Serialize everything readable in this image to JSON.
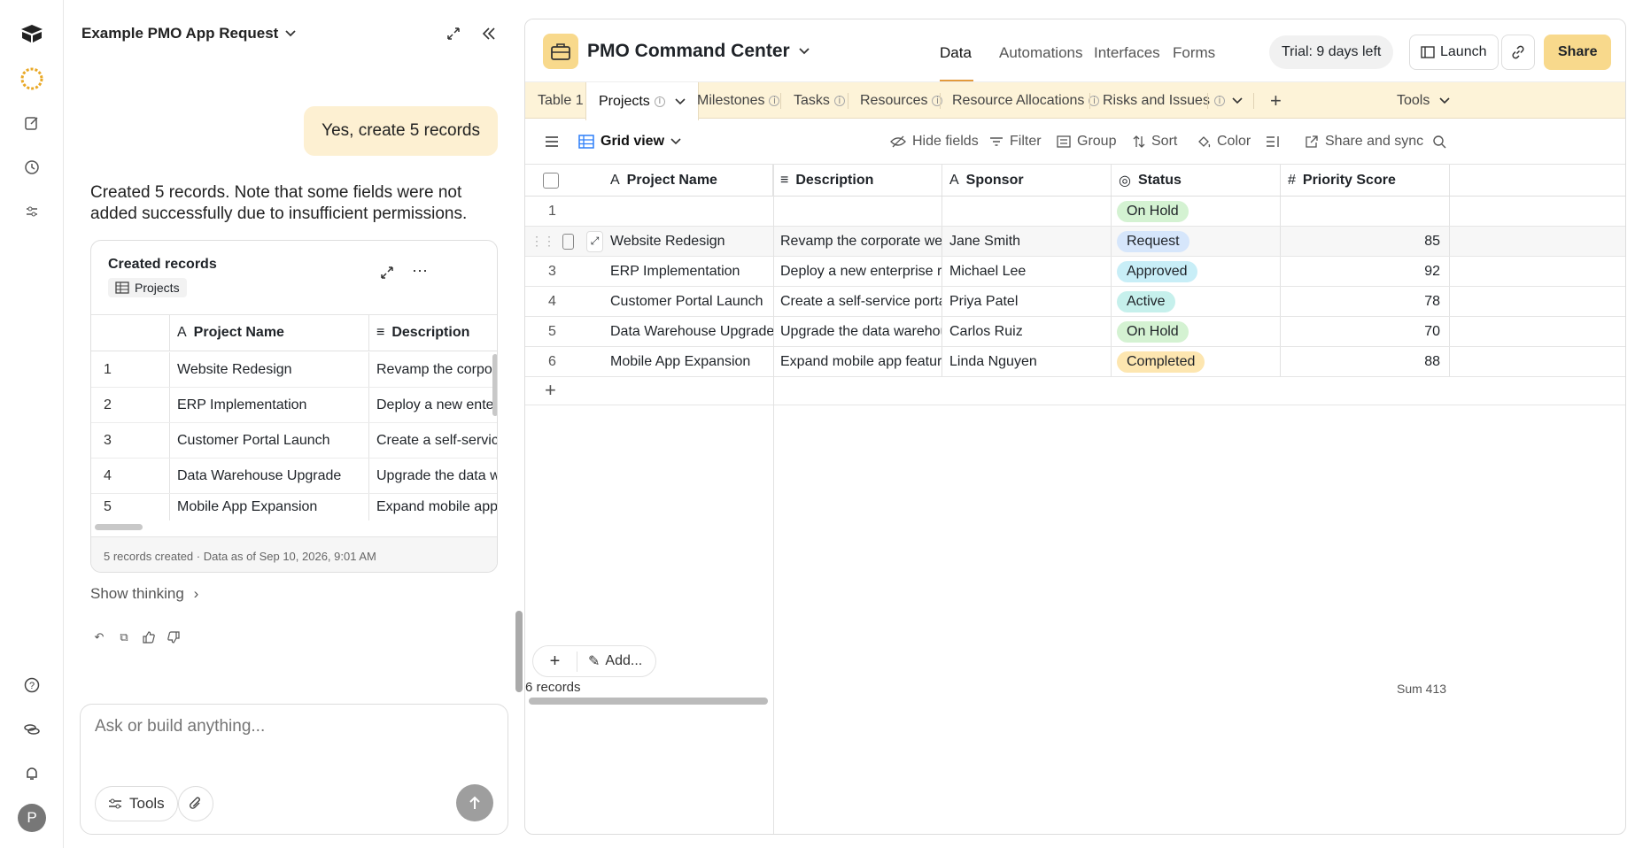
{
  "rail": {
    "icons": [
      "logo-icon",
      "sparkle-icon",
      "edit-icon",
      "history-icon",
      "sliders-icon",
      "help-icon",
      "coins-icon",
      "bell-icon"
    ],
    "avatar": "P"
  },
  "chat": {
    "title": "Example PMO App Request",
    "user_message": "Yes, create 5 records",
    "assistant_message": "Created 5 records. Note that some fields were not added successfully due to insufficient permissions.",
    "card": {
      "title": "Created records",
      "table_chip": "Projects",
      "columns": [
        "Project Name",
        "Description"
      ],
      "rows": [
        {
          "n": "1",
          "name": "Website Redesign",
          "desc": "Revamp the corpor"
        },
        {
          "n": "2",
          "name": "ERP Implementation",
          "desc": "Deploy a new enter"
        },
        {
          "n": "3",
          "name": "Customer Portal Launch",
          "desc": "Create a self-servic"
        },
        {
          "n": "4",
          "name": "Data Warehouse Upgrade",
          "desc": "Upgrade the data w"
        },
        {
          "n": "5",
          "name": "Mobile App Expansion",
          "desc": "Expand mobile app"
        }
      ],
      "footer": "5 records created · Data as of Sep 10, 2026, 9:01 AM"
    },
    "show_thinking": "Show thinking",
    "composer_placeholder": "Ask or build anything...",
    "tools_label": "Tools"
  },
  "app": {
    "base_name": "PMO Command Center",
    "nav": [
      "Data",
      "Automations",
      "Interfaces",
      "Forms"
    ],
    "trial": "Trial: 9 days left",
    "launch": "Launch",
    "share": "Share",
    "tables": [
      "Table 1",
      "Projects",
      "Milestones",
      "Tasks",
      "Resources",
      "Resource Allocations",
      "Risks and Issues"
    ],
    "tools": "Tools",
    "view_name": "Grid view",
    "toolbar": [
      "Hide fields",
      "Filter",
      "Group",
      "Sort",
      "Color",
      "Share and sync"
    ],
    "columns": [
      "Project Name",
      "Description",
      "Sponsor",
      "Status",
      "Priority Score"
    ],
    "rows": [
      {
        "n": "1",
        "name": "",
        "desc": "",
        "sponsor": "",
        "status": "On Hold",
        "score": ""
      },
      {
        "n": "",
        "name": "Website Redesign",
        "desc": "Revamp the corporate web...",
        "sponsor": "Jane Smith",
        "status": "Request",
        "score": "85"
      },
      {
        "n": "3",
        "name": "ERP Implementation",
        "desc": "Deploy a new enterprise re...",
        "sponsor": "Michael Lee",
        "status": "Approved",
        "score": "92"
      },
      {
        "n": "4",
        "name": "Customer Portal Launch",
        "desc": "Create a self-service portal ...",
        "sponsor": "Priya Patel",
        "status": "Active",
        "score": "78"
      },
      {
        "n": "5",
        "name": "Data Warehouse Upgrade",
        "desc": "Upgrade the data warehou...",
        "sponsor": "Carlos Ruiz",
        "status": "On Hold",
        "score": "70"
      },
      {
        "n": "6",
        "name": "Mobile App Expansion",
        "desc": "Expand mobile app feature...",
        "sponsor": "Linda Nguyen",
        "status": "Completed",
        "score": "88"
      }
    ],
    "status_colors": {
      "On Hold": "#d4f2d2",
      "Request": "#d6e6fb",
      "Approved": "#c8eef7",
      "Active": "#c6f0ec",
      "Completed": "#fde6b0"
    },
    "add_label": "Add...",
    "records_count": "6 records",
    "sum": "Sum 413"
  }
}
